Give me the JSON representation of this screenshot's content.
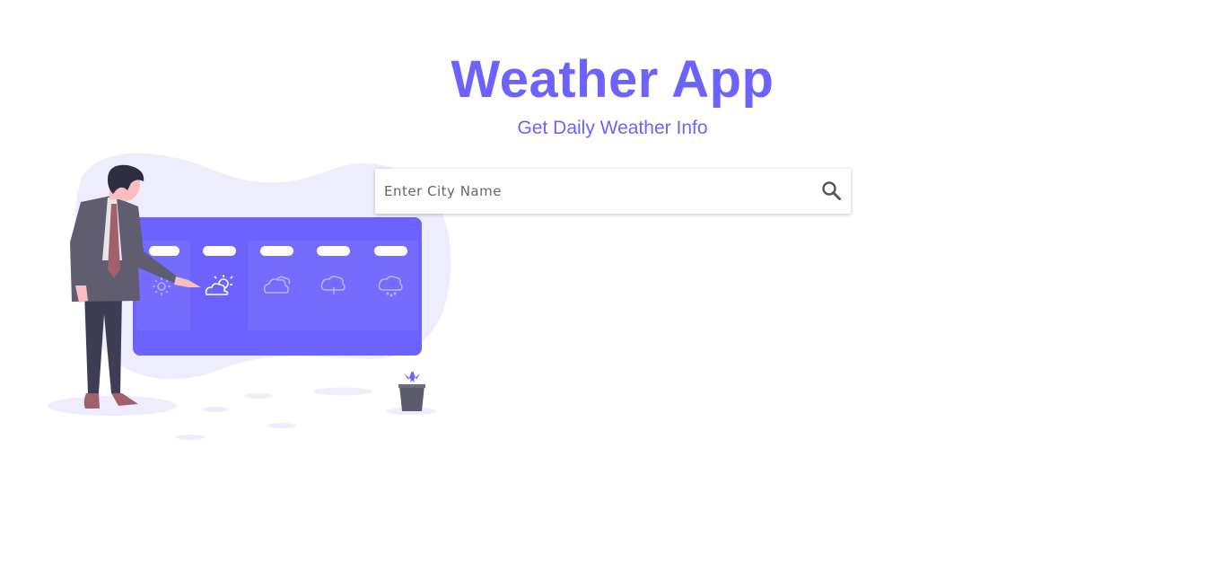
{
  "header": {
    "title": "Weather App",
    "subtitle": "Get Daily Weather Info"
  },
  "search": {
    "placeholder": "Enter City Name",
    "value": "",
    "button_icon": "search-icon"
  },
  "illustration": {
    "description_icon": "weather-presenter-illustration",
    "forecast_icons": [
      "sun-icon",
      "partly-sunny-icon",
      "cloudy-icon",
      "rain-icon",
      "snow-icon"
    ]
  },
  "colors": {
    "accent": "#6c63ff",
    "blob": "#eeedfd",
    "suit": "#5f5d6f",
    "plant_pot": "#5c5a6d"
  }
}
